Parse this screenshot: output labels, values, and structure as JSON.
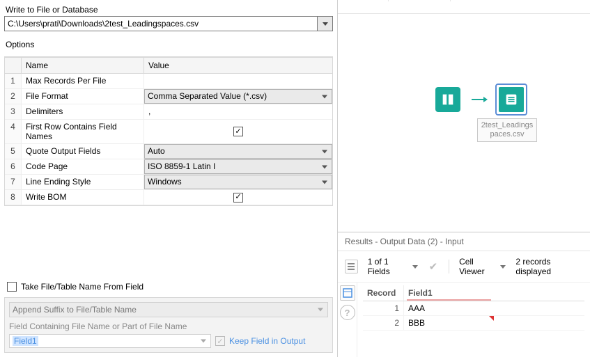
{
  "left": {
    "title": "Write to File or Database",
    "path": "C:\\Users\\prati\\Downloads\\2test_Leadingspaces.csv",
    "options_title": "Options",
    "columns": {
      "name": "Name",
      "value": "Value"
    },
    "rows": [
      {
        "n": "1",
        "name": "Max Records Per File",
        "type": "text",
        "value": ""
      },
      {
        "n": "2",
        "name": "File Format",
        "type": "select",
        "value": "Comma Separated Value (*.csv)"
      },
      {
        "n": "3",
        "name": "Delimiters",
        "type": "text",
        "value": ","
      },
      {
        "n": "4",
        "name": "First Row Contains Field Names",
        "type": "check",
        "value": true
      },
      {
        "n": "5",
        "name": "Quote Output Fields",
        "type": "select",
        "value": "Auto"
      },
      {
        "n": "6",
        "name": "Code Page",
        "type": "select",
        "value": "ISO 8859-1 Latin I"
      },
      {
        "n": "7",
        "name": "Line Ending Style",
        "type": "select",
        "value": "Windows"
      },
      {
        "n": "8",
        "name": "Write BOM",
        "type": "check",
        "value": true
      }
    ],
    "take_from_field": "Take File/Table Name From Field",
    "append_mode": "Append Suffix to File/Table Name",
    "field_label": "Field Containing File Name or Part of File Name",
    "field_value": "Field1",
    "keep_label": "Keep Field in Output"
  },
  "canvas": {
    "output_label": "2test_Leadingspaces.csv"
  },
  "results": {
    "title": "Results - Output Data (2) - Input",
    "fields_summary": "1 of 1 Fields",
    "cell_viewer": "Cell Viewer",
    "records_display": "2 records displayed",
    "columns": {
      "record": "Record",
      "f1": "Field1"
    },
    "rows": [
      {
        "rec": "1",
        "f1": "AAA",
        "flag": false
      },
      {
        "rec": "2",
        "f1": "BBB",
        "flag": true
      }
    ]
  }
}
